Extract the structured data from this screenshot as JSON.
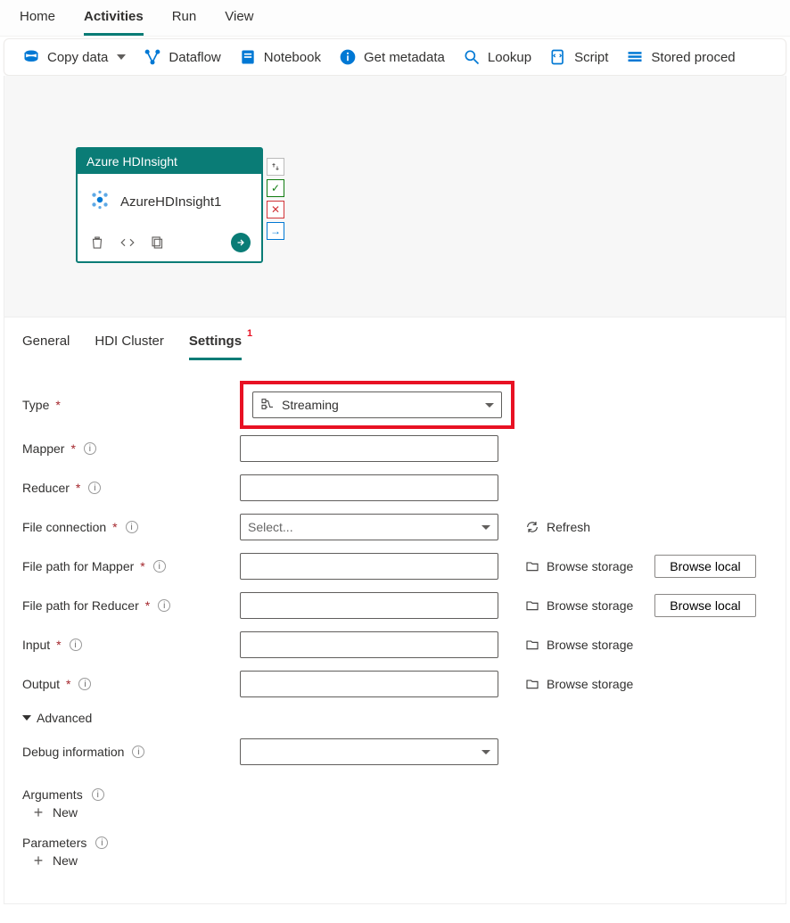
{
  "topTabs": {
    "home": "Home",
    "activities": "Activities",
    "run": "Run",
    "view": "View"
  },
  "toolbar": {
    "copyData": "Copy data",
    "dataflow": "Dataflow",
    "notebook": "Notebook",
    "getMetadata": "Get metadata",
    "lookup": "Lookup",
    "script": "Script",
    "storedProcedure": "Stored proced"
  },
  "activity": {
    "type": "Azure HDInsight",
    "name": "AzureHDInsight1"
  },
  "panelTabs": {
    "general": "General",
    "hdi": "HDI Cluster",
    "settings": "Settings",
    "settingsBadge": "1"
  },
  "settings": {
    "typeLabel": "Type",
    "typeValue": "Streaming",
    "mapperLabel": "Mapper",
    "reducerLabel": "Reducer",
    "fileConnLabel": "File connection",
    "fileConnPlaceholder": "Select...",
    "refresh": "Refresh",
    "filePathMapperLabel": "File path for Mapper",
    "filePathReducerLabel": "File path for Reducer",
    "inputLabel": "Input",
    "outputLabel": "Output",
    "browseStorage": "Browse storage",
    "browseLocal": "Browse local",
    "advanced": "Advanced",
    "debugLabel": "Debug information",
    "argsLabel": "Arguments",
    "paramsLabel": "Parameters",
    "newLabel": "New"
  }
}
